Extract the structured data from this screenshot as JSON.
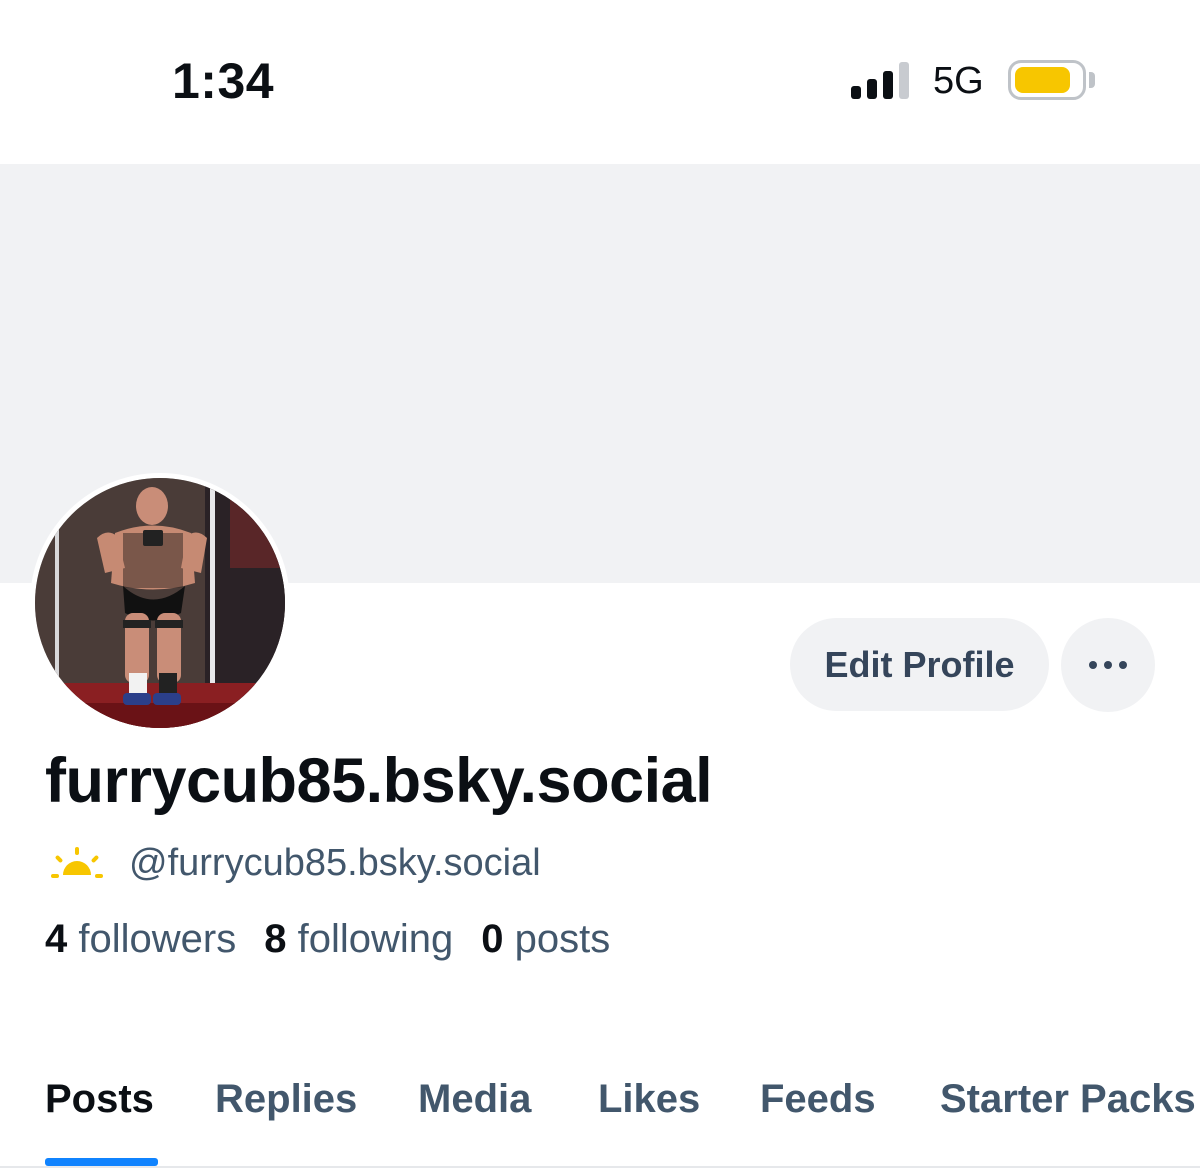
{
  "status_bar": {
    "time": "1:34",
    "network": "5G",
    "signal_bars_active": 3,
    "signal_bars_total": 4,
    "battery_level": 0.72,
    "battery_color": "#f7c600"
  },
  "profile": {
    "display_name": "furrycub85.bsky.social",
    "handle": "@furrycub85.bsky.social",
    "handle_icon": "sun-icon",
    "followers_count": "4",
    "followers_label": "followers",
    "following_count": "8",
    "following_label": "following",
    "posts_count": "0",
    "posts_label": "posts"
  },
  "actions": {
    "edit_profile_label": "Edit Profile",
    "more_icon": "ellipsis-icon"
  },
  "tabs": [
    {
      "label": "Posts",
      "active": true
    },
    {
      "label": "Replies",
      "active": false
    },
    {
      "label": "Media",
      "active": false
    },
    {
      "label": "Likes",
      "active": false
    },
    {
      "label": "Feeds",
      "active": false
    },
    {
      "label": "Starter Packs",
      "active": false
    }
  ],
  "colors": {
    "accent": "#1083fe",
    "muted_text": "#42576c",
    "banner": "#f1f2f4"
  }
}
